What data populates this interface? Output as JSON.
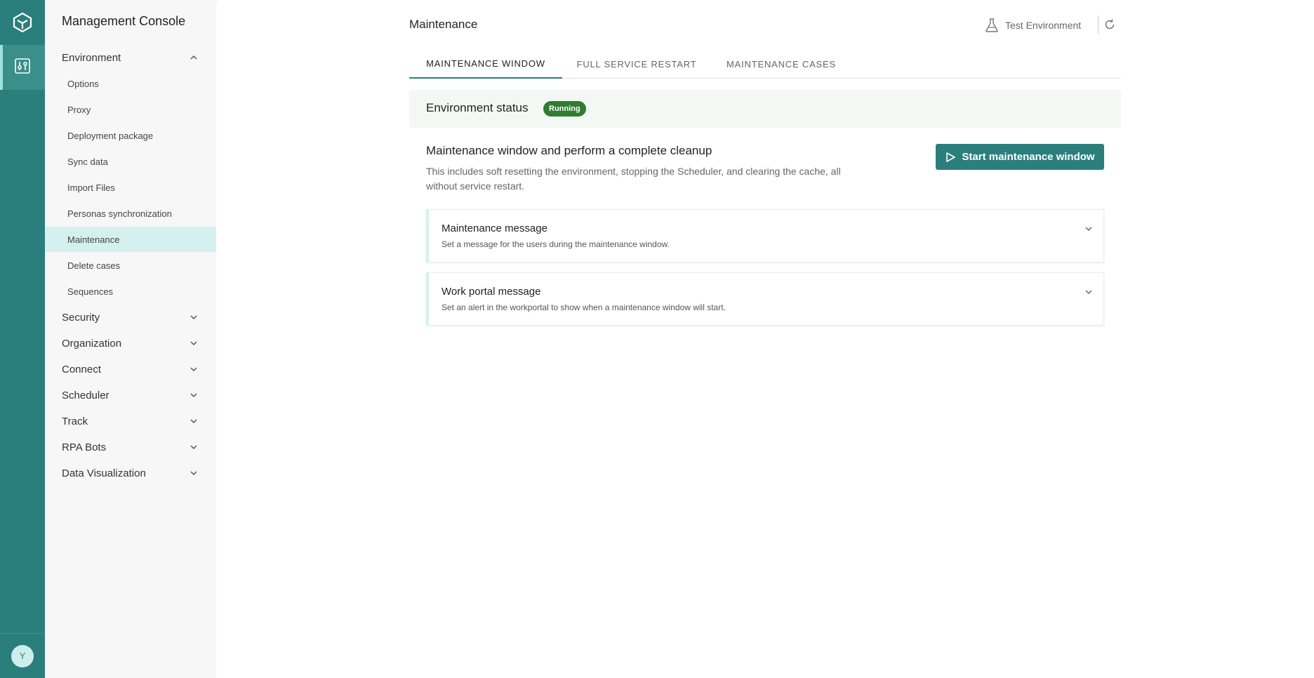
{
  "app": {
    "title": "Management Console"
  },
  "user": {
    "initial": "Y"
  },
  "rail": {
    "logo_icon": "hexagon-logo-icon",
    "active_icon": "sliders-icon"
  },
  "sidebar": {
    "environment": {
      "label": "Environment",
      "expanded": true,
      "items": [
        {
          "label": "Options"
        },
        {
          "label": "Proxy"
        },
        {
          "label": "Deployment package"
        },
        {
          "label": "Sync data"
        },
        {
          "label": "Import Files"
        },
        {
          "label": "Personas synchronization"
        },
        {
          "label": "Maintenance",
          "active": true
        },
        {
          "label": "Delete cases"
        },
        {
          "label": "Sequences"
        }
      ]
    },
    "sections": [
      {
        "label": "Security"
      },
      {
        "label": "Organization"
      },
      {
        "label": "Connect"
      },
      {
        "label": "Scheduler"
      },
      {
        "label": "Track"
      },
      {
        "label": "RPA Bots"
      },
      {
        "label": "Data Visualization"
      }
    ]
  },
  "header": {
    "title": "Maintenance",
    "environment": "Test Environment"
  },
  "tabs": [
    {
      "label": "MAINTENANCE WINDOW",
      "active": true
    },
    {
      "label": "FULL SERVICE RESTART"
    },
    {
      "label": "MAINTENANCE CASES"
    }
  ],
  "status": {
    "label": "Environment status",
    "badge": "Running",
    "badge_color": "#2e7d32"
  },
  "maintenance": {
    "title": "Maintenance window and perform a complete cleanup",
    "description": "This includes soft resetting the environment, stopping the Scheduler, and clearing the cache, all without service restart.",
    "start_button": "Start maintenance window"
  },
  "cards": [
    {
      "title": "Maintenance message",
      "subtitle": "Set a message for the users during the maintenance window."
    },
    {
      "title": "Work portal message",
      "subtitle": "Set an alert in the workportal to show when a maintenance window will start."
    }
  ],
  "colors": {
    "primary": "#2a7f7c",
    "active_bg": "#d4f1ef",
    "status_bg": "#f3f8f4"
  }
}
